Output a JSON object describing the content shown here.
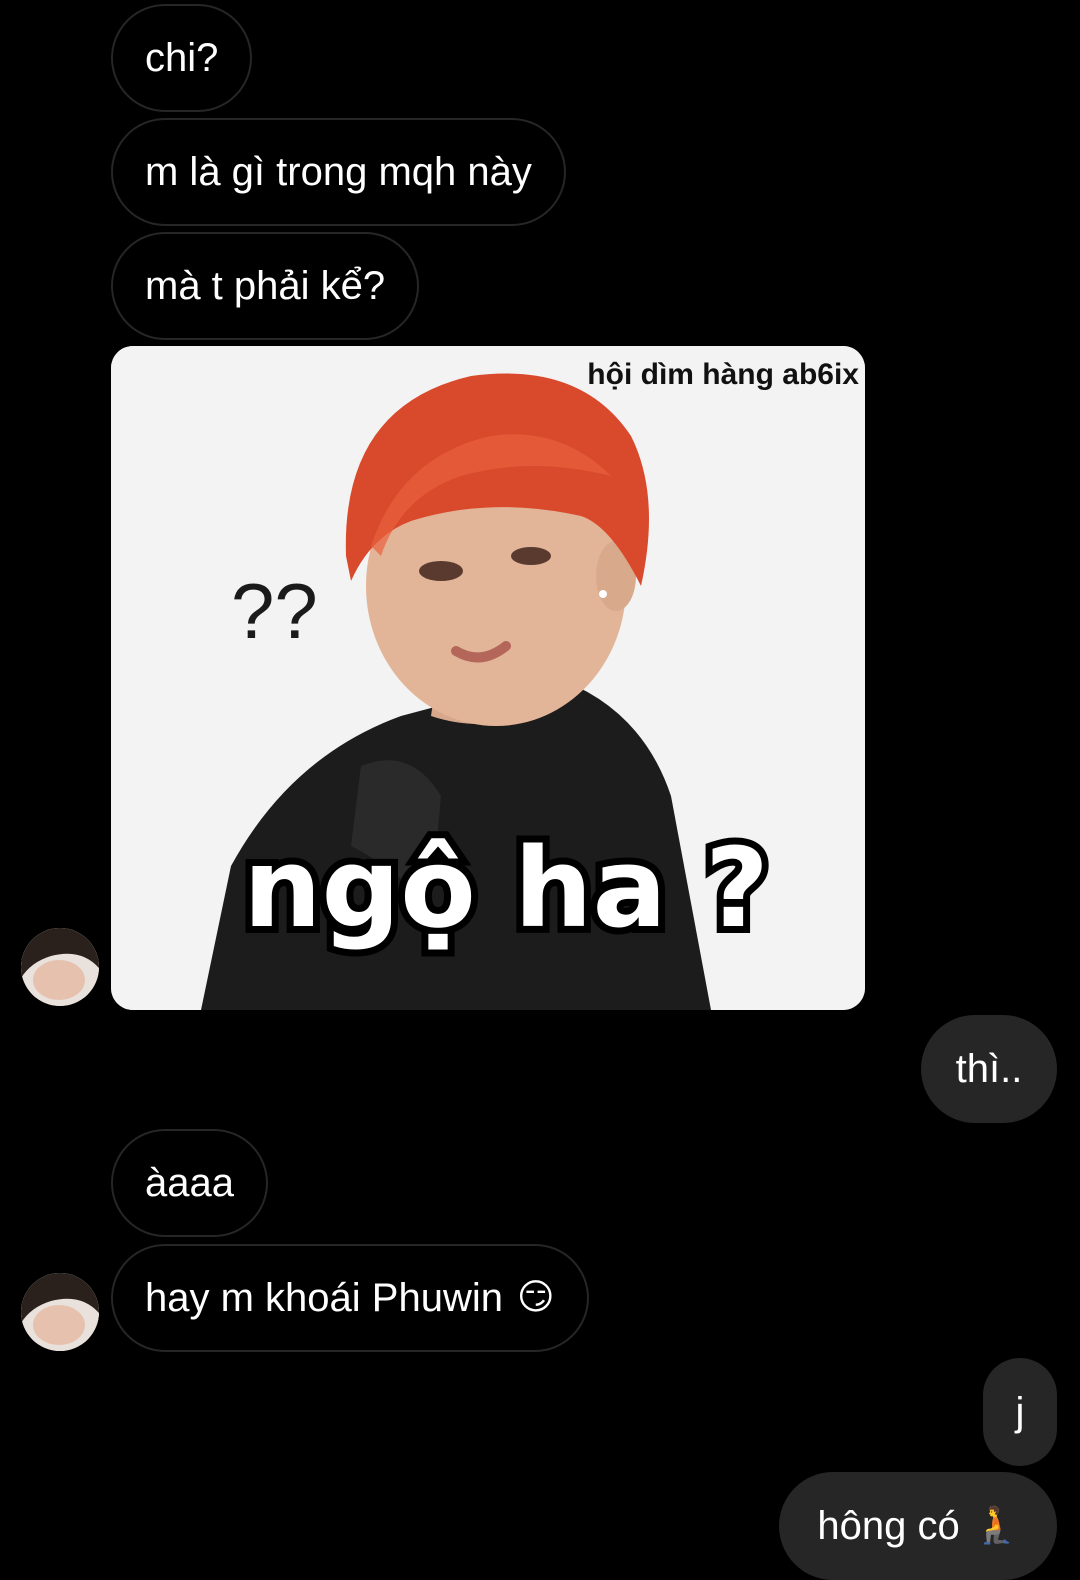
{
  "messages": {
    "m1": "chi?",
    "m2": "m là gì trong mqh này",
    "m3": "mà t phải kể?",
    "m4": "thì..",
    "m5": "àaaa",
    "m6": "hay m khoái Phuwin",
    "m6_emoji": "😏",
    "m7": "j",
    "m8": "hông có",
    "m8_emoji": "🧎"
  },
  "sticker": {
    "watermark": "hội dìm hàng ab6ix",
    "question": "??",
    "caption": "ngộ ha ?"
  },
  "colors": {
    "background": "#000000",
    "outgoing_bubble": "#262626",
    "incoming_border": "#262626",
    "hair": "#d94a2c"
  }
}
